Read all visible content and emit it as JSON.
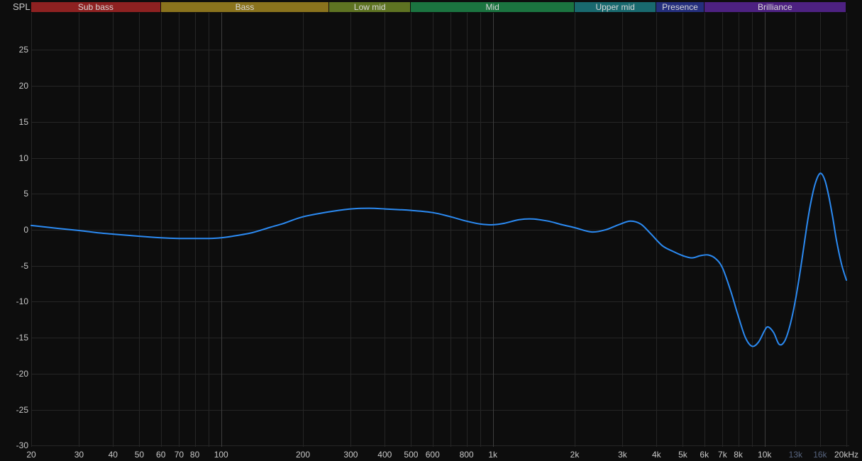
{
  "chart_data": {
    "type": "line",
    "ylabel": "SPL",
    "x_scale": "log",
    "x_unit": "Hz",
    "x_range": [
      20,
      20000
    ],
    "y_range": [
      -30,
      30
    ],
    "grid": true,
    "y_ticks": [
      25,
      20,
      15,
      10,
      5,
      0,
      -5,
      -10,
      -15,
      -20,
      -25,
      -30
    ],
    "x_ticks": [
      {
        "f": 20,
        "label": "20",
        "dim": false
      },
      {
        "f": 30,
        "label": "30",
        "dim": false
      },
      {
        "f": 40,
        "label": "40",
        "dim": false
      },
      {
        "f": 50,
        "label": "50",
        "dim": false
      },
      {
        "f": 60,
        "label": "60",
        "dim": false
      },
      {
        "f": 70,
        "label": "70",
        "dim": false
      },
      {
        "f": 80,
        "label": "80",
        "dim": false
      },
      {
        "f": 100,
        "label": "100",
        "dim": false
      },
      {
        "f": 200,
        "label": "200",
        "dim": false
      },
      {
        "f": 300,
        "label": "300",
        "dim": false
      },
      {
        "f": 400,
        "label": "400",
        "dim": false
      },
      {
        "f": 500,
        "label": "500",
        "dim": false
      },
      {
        "f": 600,
        "label": "600",
        "dim": false
      },
      {
        "f": 800,
        "label": "800",
        "dim": false
      },
      {
        "f": 1000,
        "label": "1k",
        "dim": false
      },
      {
        "f": 2000,
        "label": "2k",
        "dim": false
      },
      {
        "f": 3000,
        "label": "3k",
        "dim": false
      },
      {
        "f": 4000,
        "label": "4k",
        "dim": false
      },
      {
        "f": 5000,
        "label": "5k",
        "dim": false
      },
      {
        "f": 6000,
        "label": "6k",
        "dim": false
      },
      {
        "f": 7000,
        "label": "7k",
        "dim": false
      },
      {
        "f": 8000,
        "label": "8k",
        "dim": false
      },
      {
        "f": 10000,
        "label": "10k",
        "dim": false
      },
      {
        "f": 13000,
        "label": "13k",
        "dim": true
      },
      {
        "f": 16000,
        "label": "16k",
        "dim": true
      },
      {
        "f": 20000,
        "label": "20kHz",
        "dim": false
      }
    ],
    "x_gridlines": [
      20,
      30,
      40,
      50,
      60,
      70,
      80,
      90,
      100,
      200,
      300,
      400,
      500,
      600,
      700,
      800,
      900,
      1000,
      2000,
      3000,
      4000,
      5000,
      6000,
      7000,
      8000,
      9000,
      10000,
      13000,
      16000,
      20000
    ],
    "x_major_gridlines": [
      100,
      1000,
      10000
    ],
    "bands": [
      {
        "label": "Sub bass",
        "from": 20,
        "to": 60,
        "color": "#8e2121"
      },
      {
        "label": "Bass",
        "from": 60,
        "to": 250,
        "color": "#8a731d"
      },
      {
        "label": "Low mid",
        "from": 250,
        "to": 500,
        "color": "#5e7322"
      },
      {
        "label": "Mid",
        "from": 500,
        "to": 2000,
        "color": "#1b7440"
      },
      {
        "label": "Upper mid",
        "from": 2000,
        "to": 4000,
        "color": "#19696e"
      },
      {
        "label": "Presence",
        "from": 4000,
        "to": 6000,
        "color": "#252f7d"
      },
      {
        "label": "Brilliance",
        "from": 6000,
        "to": 20000,
        "color": "#4d2181"
      }
    ],
    "series": [
      {
        "name": "frequency-response",
        "color": "#2b8af2",
        "points": [
          [
            20,
            0.6
          ],
          [
            25,
            0.2
          ],
          [
            30,
            -0.1
          ],
          [
            35,
            -0.4
          ],
          [
            40,
            -0.6
          ],
          [
            50,
            -0.9
          ],
          [
            60,
            -1.1
          ],
          [
            70,
            -1.2
          ],
          [
            80,
            -1.2
          ],
          [
            90,
            -1.2
          ],
          [
            100,
            -1.1
          ],
          [
            110,
            -0.9
          ],
          [
            130,
            -0.4
          ],
          [
            150,
            0.3
          ],
          [
            170,
            0.9
          ],
          [
            200,
            1.8
          ],
          [
            250,
            2.5
          ],
          [
            300,
            2.9
          ],
          [
            350,
            3.0
          ],
          [
            400,
            2.9
          ],
          [
            450,
            2.8
          ],
          [
            500,
            2.7
          ],
          [
            600,
            2.4
          ],
          [
            700,
            1.8
          ],
          [
            800,
            1.2
          ],
          [
            900,
            0.8
          ],
          [
            1000,
            0.7
          ],
          [
            1100,
            0.9
          ],
          [
            1250,
            1.4
          ],
          [
            1400,
            1.5
          ],
          [
            1600,
            1.2
          ],
          [
            1800,
            0.7
          ],
          [
            2000,
            0.3
          ],
          [
            2300,
            -0.3
          ],
          [
            2600,
            0.0
          ],
          [
            2900,
            0.7
          ],
          [
            3200,
            1.2
          ],
          [
            3500,
            0.8
          ],
          [
            3800,
            -0.5
          ],
          [
            4200,
            -2.2
          ],
          [
            4600,
            -3.0
          ],
          [
            5000,
            -3.6
          ],
          [
            5400,
            -3.9
          ],
          [
            5800,
            -3.6
          ],
          [
            6200,
            -3.5
          ],
          [
            6600,
            -4.0
          ],
          [
            7000,
            -5.3
          ],
          [
            7500,
            -8.5
          ],
          [
            8000,
            -12.0
          ],
          [
            8500,
            -15.0
          ],
          [
            9000,
            -16.2
          ],
          [
            9500,
            -15.6
          ],
          [
            10000,
            -14.0
          ],
          [
            10300,
            -13.5
          ],
          [
            10800,
            -14.3
          ],
          [
            11300,
            -15.9
          ],
          [
            11800,
            -15.6
          ],
          [
            12300,
            -13.8
          ],
          [
            12800,
            -11.0
          ],
          [
            13300,
            -7.5
          ],
          [
            13800,
            -3.5
          ],
          [
            14300,
            0.5
          ],
          [
            14800,
            3.8
          ],
          [
            15300,
            6.2
          ],
          [
            15800,
            7.6
          ],
          [
            16200,
            7.8
          ],
          [
            16700,
            6.8
          ],
          [
            17200,
            4.8
          ],
          [
            17800,
            1.8
          ],
          [
            18400,
            -1.5
          ],
          [
            19200,
            -4.8
          ],
          [
            20000,
            -7.0
          ]
        ]
      }
    ]
  },
  "colors": {
    "background": "#0d0d0d",
    "grid_minor": "#262626",
    "grid_major": "#3d3d3d",
    "tick_text": "#c9c9c9",
    "dim_tick_text": "#56637d",
    "band_text": "#d8d8d8",
    "curve": "#2b8af2"
  }
}
